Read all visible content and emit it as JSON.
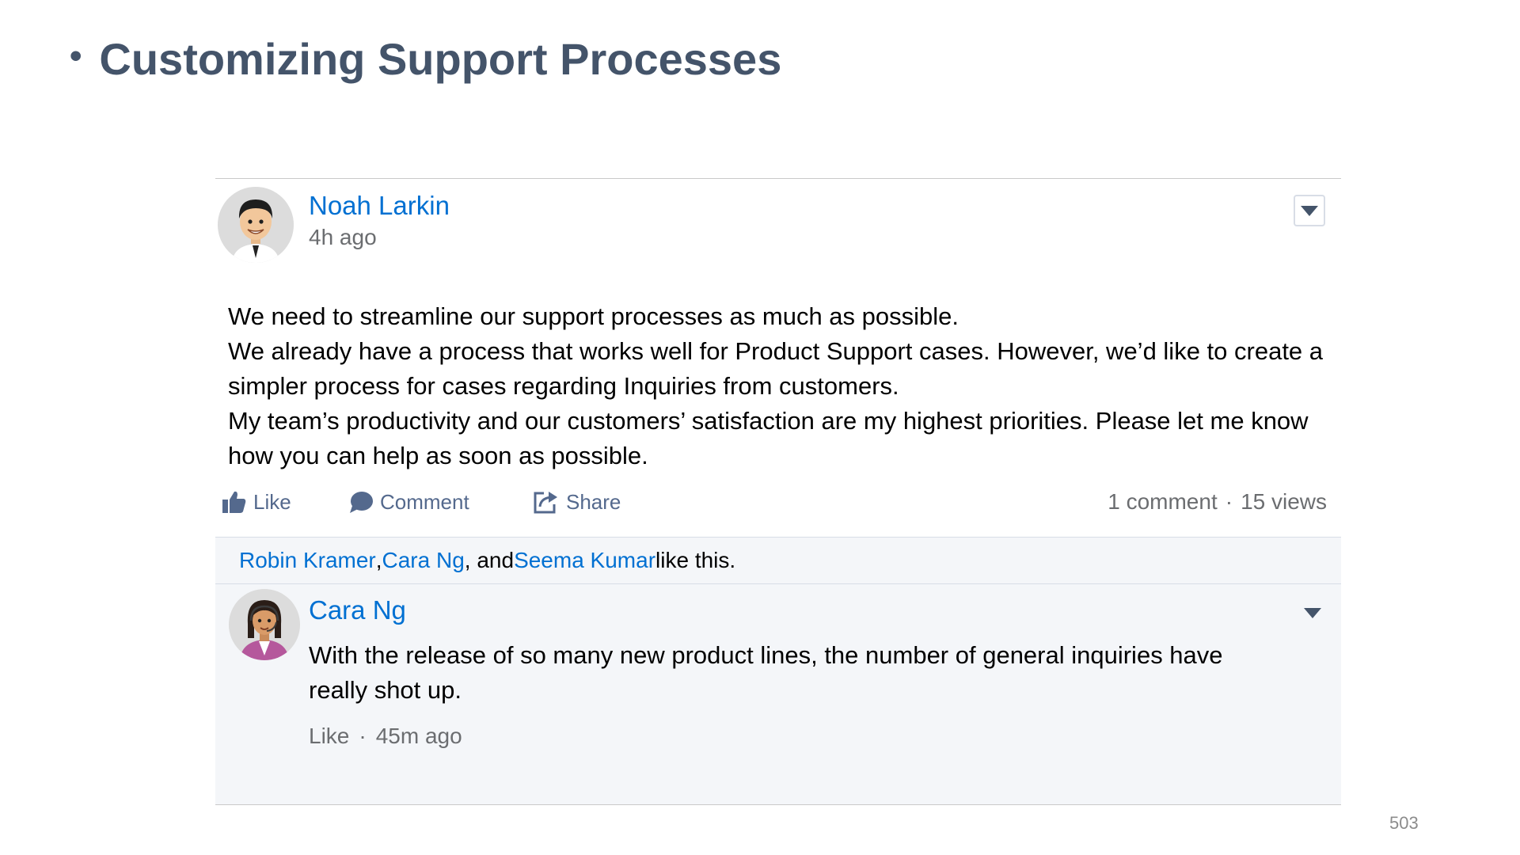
{
  "slide": {
    "title": "Customizing Support Processes",
    "page_number": "503"
  },
  "post": {
    "author": "Noah Larkin",
    "time": "4h ago",
    "body": [
      "We need to streamline our support processes as much as possible.",
      "We already have a process that works well for Product Support cases. However, we’d like to create a simpler process for cases regarding Inquiries from customers.",
      "My team’s productivity and our customers’ satisfaction are my highest priorities. Please let me know how you can help as soon as possible."
    ],
    "actions": {
      "like": "Like",
      "comment": "Comment",
      "share": "Share"
    },
    "stats": {
      "comments": "1 comment",
      "separator": "·",
      "views": "15 views"
    },
    "likes": {
      "likers": [
        "Robin Kramer",
        "Cara Ng",
        "Seema Kumar"
      ],
      "sep1": ", ",
      "sep2": ", and ",
      "suffix": " like this."
    }
  },
  "comment": {
    "author": "Cara Ng",
    "text": "With the release of so many new product lines, the number of general inquiries have really shot up.",
    "like": "Like",
    "separator": "·",
    "time": "45m ago"
  },
  "colors": {
    "link": "#0070d2",
    "title": "#44546a",
    "action": "#54698d",
    "muted": "#6b6d70",
    "comment_bg": "#f4f6f9"
  }
}
